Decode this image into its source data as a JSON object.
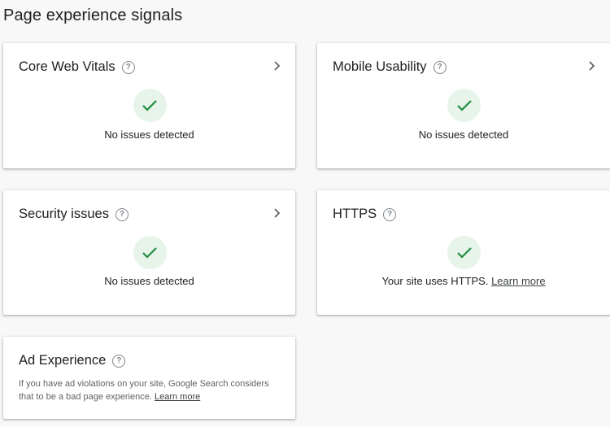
{
  "page": {
    "title": "Page experience signals"
  },
  "cards": {
    "core_web_vitals": {
      "title": "Core Web Vitals",
      "status": "No issues detected"
    },
    "mobile_usability": {
      "title": "Mobile Usability",
      "status": "No issues detected"
    },
    "security_issues": {
      "title": "Security issues",
      "status": "No issues detected"
    },
    "https": {
      "title": "HTTPS",
      "status": "Your site uses HTTPS.",
      "link": "Learn more"
    },
    "ad_experience": {
      "title": "Ad Experience",
      "description": "If you have ad violations on your site, Google Search considers that to be a bad page experience.",
      "link": "Learn more"
    }
  },
  "icons": {
    "help": "help-circle-icon",
    "chevron": "chevron-right-icon",
    "check": "check-icon"
  },
  "colors": {
    "check": "#1e8e3e",
    "check_bg": "#e6f4ea"
  }
}
